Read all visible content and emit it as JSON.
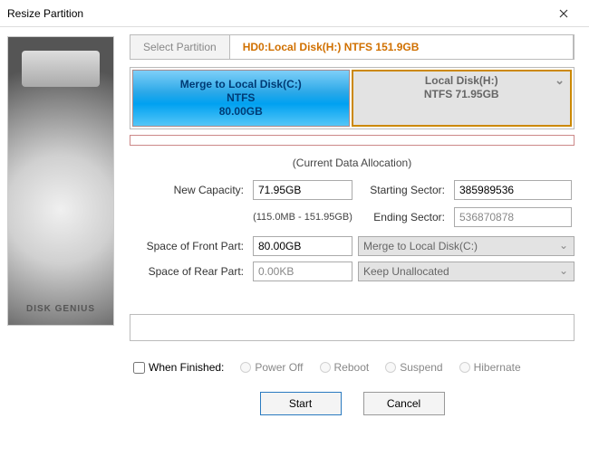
{
  "window": {
    "title": "Resize Partition"
  },
  "tabs": {
    "select": "Select Partition",
    "active": "HD0:Local Disk(H:) NTFS 151.9GB"
  },
  "partitions": {
    "left": {
      "l1": "Merge to Local Disk(C:)",
      "l2": "NTFS",
      "l3": "80.00GB"
    },
    "right": {
      "l1": "Local Disk(H:)",
      "l2": "NTFS 71.95GB"
    }
  },
  "alloc": "(Current Data Allocation)",
  "fields": {
    "newcap_label": "New Capacity:",
    "newcap": "71.95GB",
    "range": "(115.0MB - 151.95GB)",
    "startsec_label": "Starting Sector:",
    "startsec": "385989536",
    "endsec_label": "Ending Sector:",
    "endsec": "536870878",
    "front_label": "Space of Front Part:",
    "front": "80.00GB",
    "front_sel": "Merge to Local Disk(C:)",
    "rear_label": "Space of Rear Part:",
    "rear": "0.00KB",
    "rear_sel": "Keep Unallocated"
  },
  "finish": {
    "label": "When Finished:",
    "poweroff": "Power Off",
    "reboot": "Reboot",
    "suspend": "Suspend",
    "hibernate": "Hibernate"
  },
  "buttons": {
    "start": "Start",
    "cancel": "Cancel"
  }
}
